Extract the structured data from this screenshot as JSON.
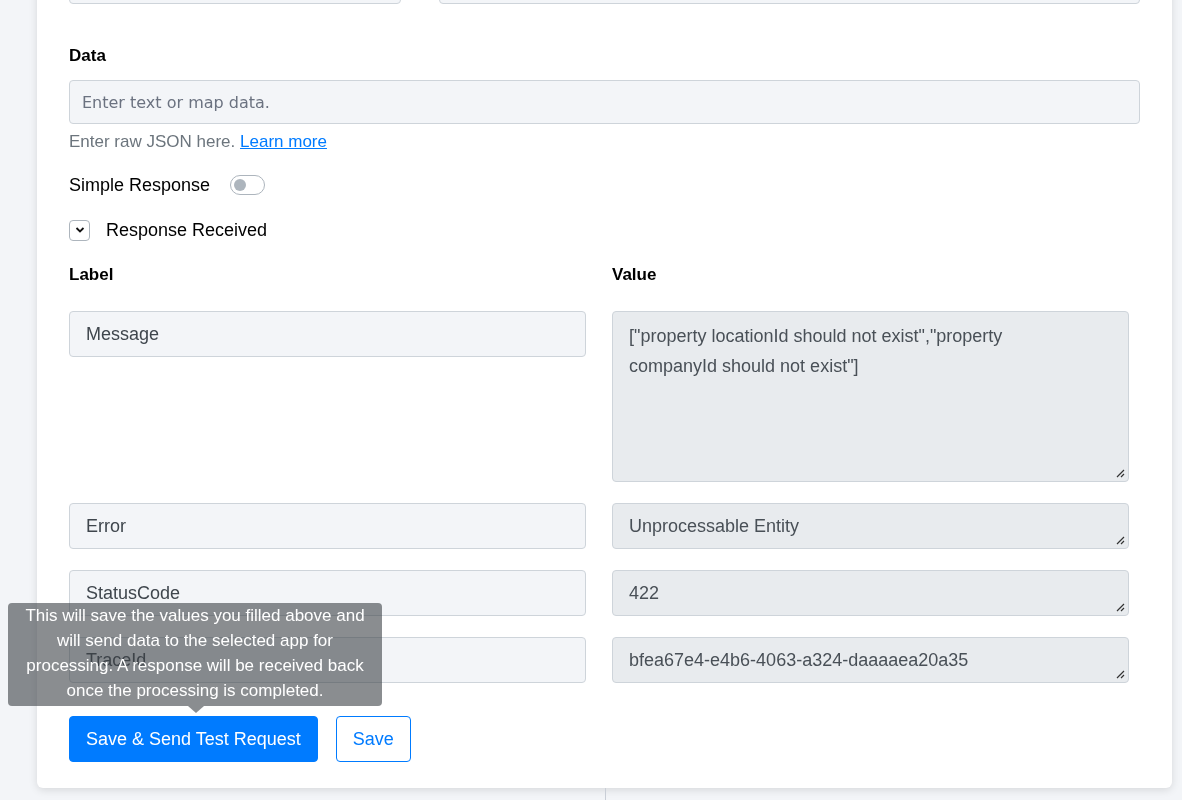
{
  "data_field": {
    "label": "Data",
    "placeholder": "Enter text or map data.",
    "help": "Enter raw JSON here.",
    "help_link": "Learn more"
  },
  "simple_response": {
    "label": "Simple Response",
    "on": false
  },
  "response": {
    "title": "Response Received",
    "expanded": true,
    "columns": [
      "Label",
      "Value"
    ],
    "rows": [
      {
        "kind": "multiline",
        "label": "Message",
        "value": "[\"property locationId should not exist\",\"property companyId should not exist\"]"
      },
      {
        "kind": "single",
        "label": "Error",
        "value": "Unprocessable Entity"
      },
      {
        "kind": "single",
        "label": "StatusCode",
        "value": "422"
      },
      {
        "kind": "single",
        "label": "TraceId",
        "value": "bfea67e4-e4b6-4063-a324-daaaaea20a35"
      }
    ]
  },
  "buttons": [
    {
      "kind": "primary",
      "label": "Save & Send Test Request"
    },
    {
      "kind": "outline",
      "label": "Save"
    }
  ],
  "tooltip": {
    "text": "This will save the values you filled above and will send data to the selected app for processing. A response will be received back once the processing is completed."
  }
}
